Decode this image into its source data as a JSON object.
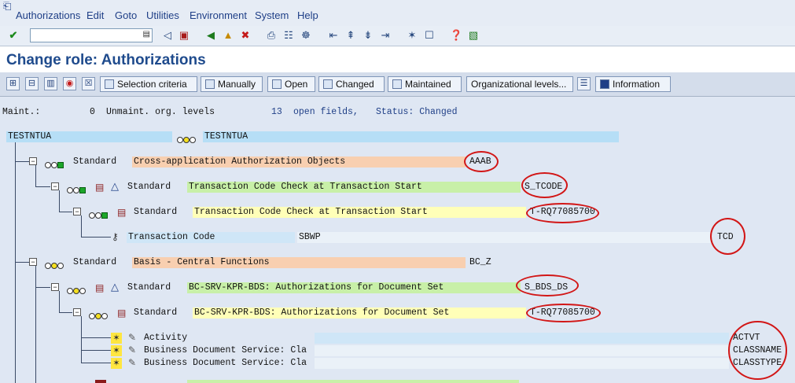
{
  "menu": {
    "items": [
      "Authorizations",
      "Edit",
      "Goto",
      "Utilities",
      "Environment",
      "System",
      "Help"
    ]
  },
  "title": "Change role: Authorizations",
  "app_toolbar": {
    "buttons": [
      "Selection criteria",
      "Manually",
      "Open",
      "Changed",
      "Maintained",
      "Organizational levels...",
      "Information"
    ]
  },
  "status": {
    "maint_label": "Maint.:",
    "maint_count": "0",
    "unmaint_label": "Unmaint. org. levels",
    "open_count": "13",
    "open_label": "open fields,",
    "status_label": "Status: Changed"
  },
  "tree": {
    "root_left": "TESTNTUA",
    "root_right": "TESTNTUA",
    "rows": [
      {
        "label": "Standard",
        "text": "Cross-application Authorization Objects",
        "code": "AAAB"
      },
      {
        "label": "Standard",
        "text": "Transaction Code Check at Transaction Start",
        "code": "S_TCODE"
      },
      {
        "label": "Standard",
        "text": "Transaction Code Check at Transaction Start",
        "code": "T-RQ77085700"
      },
      {
        "label": "Transaction Code",
        "value": "SBWP",
        "code": "TCD"
      },
      {
        "label": "Standard",
        "text": "Basis - Central Functions",
        "code": "BC_Z"
      },
      {
        "label": "Standard",
        "text": "BC-SRV-KPR-BDS: Authorizations for Document Set",
        "code": "S_BDS_DS"
      },
      {
        "label": "Standard",
        "text": "BC-SRV-KPR-BDS: Authorizations for Document Set",
        "code": "T-RQ77085700"
      },
      {
        "label": "Activity",
        "code": "ACTVT"
      },
      {
        "label": "Business Document Service: Cla",
        "code": "CLASSNAME"
      },
      {
        "label": "Business Document Service: Cla",
        "code": "CLASSTYPE"
      }
    ]
  },
  "colors": {
    "title": "#1f4b8d",
    "annotation_ring": "#d21616",
    "object_class_bg": "#f8cfb0",
    "object_bg": "#c8f0a8",
    "auth_bg": "#ffffb8",
    "field_bg": "#b6def6"
  }
}
